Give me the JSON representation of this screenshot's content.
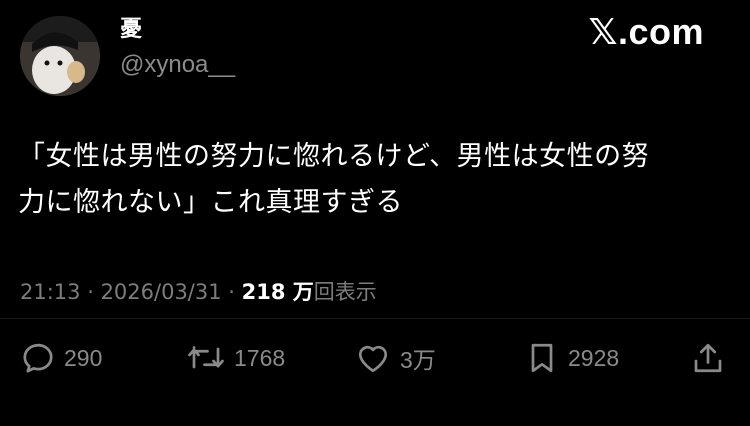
{
  "user": {
    "display_name": "憂",
    "handle": "@xynoa__"
  },
  "watermark": {
    "x": "𝕏",
    "domain": ".com"
  },
  "tweet": {
    "text_line1": "「女性は男性の努力に惚れるけど、男性は女性の努",
    "text_line2": "力に惚れない」これ真理すぎる"
  },
  "meta": {
    "time": "21:13",
    "sep1": " · ",
    "date": "2026/03/31",
    "sep2": " · ",
    "views_count": "218 万",
    "views_label": "回表示"
  },
  "actions": {
    "reply_icon": "reply-icon",
    "reply_count": "290",
    "retweet_icon": "retweet-icon",
    "retweet_count": "1768",
    "like_icon": "heart-icon",
    "like_count": "3万",
    "bookmark_icon": "bookmark-icon",
    "bookmark_count": "2928",
    "share_icon": "share-icon"
  },
  "colors": {
    "background": "#000000",
    "text": "#ffffff",
    "muted": "#7d7d7d"
  }
}
